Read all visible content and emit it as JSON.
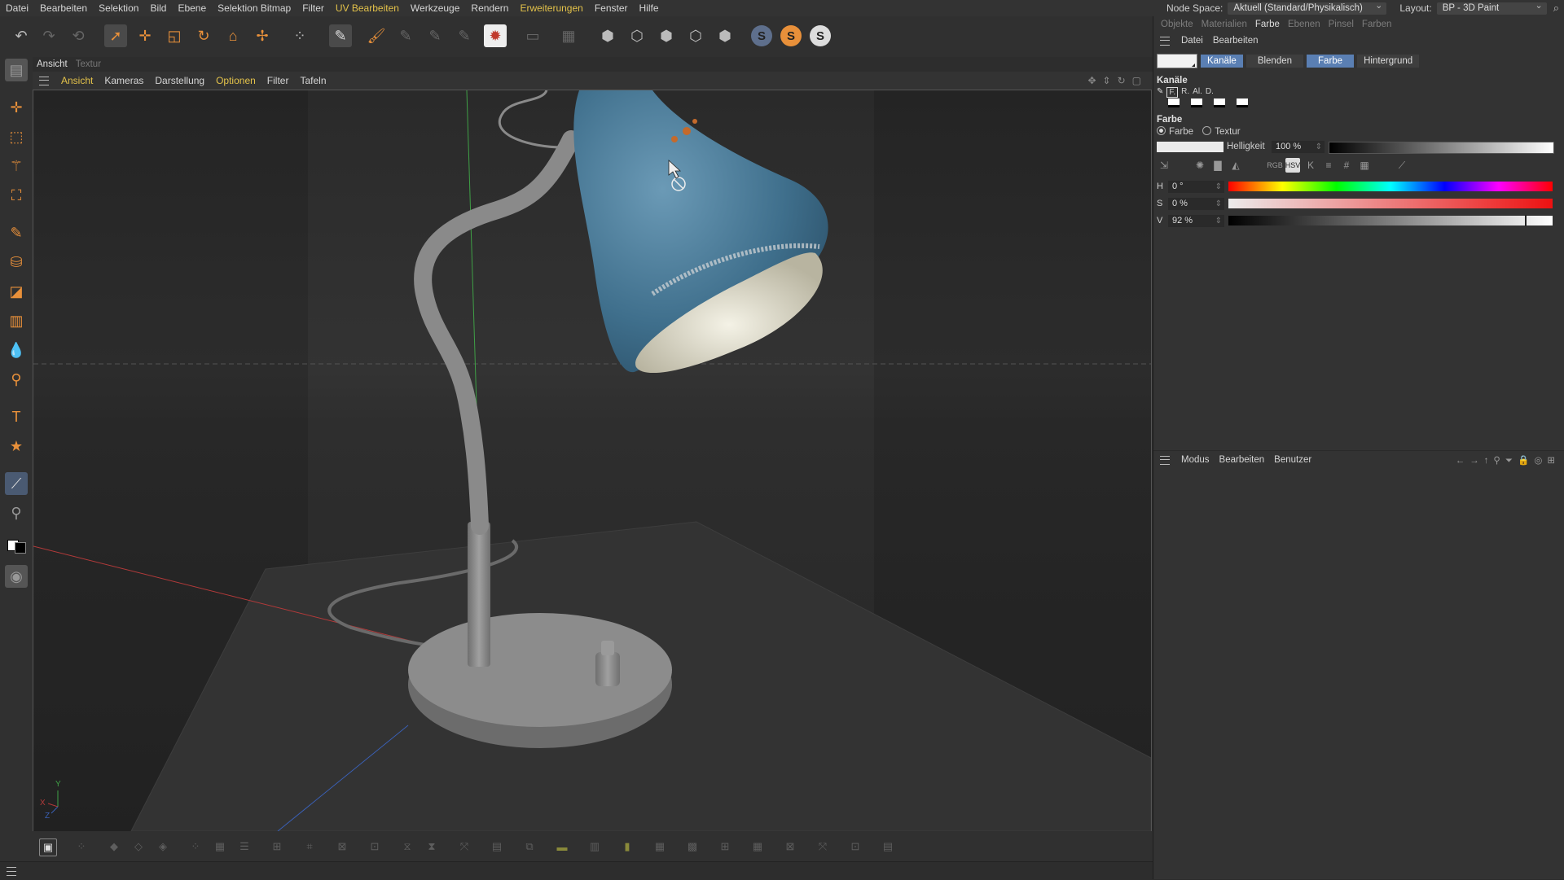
{
  "menubar": {
    "items": [
      {
        "label": "Datei",
        "hl": false
      },
      {
        "label": "Bearbeiten",
        "hl": false
      },
      {
        "label": "Selektion",
        "hl": false
      },
      {
        "label": "Bild",
        "hl": false
      },
      {
        "label": "Ebene",
        "hl": false
      },
      {
        "label": "Selektion Bitmap",
        "hl": false
      },
      {
        "label": "Filter",
        "hl": false
      },
      {
        "label": "UV Bearbeiten",
        "hl": true
      },
      {
        "label": "Werkzeuge",
        "hl": false
      },
      {
        "label": "Rendern",
        "hl": false
      },
      {
        "label": "Erweiterungen",
        "hl": true
      },
      {
        "label": "Fenster",
        "hl": false
      },
      {
        "label": "Hilfe",
        "hl": false
      }
    ],
    "node_space_label": "Node Space:",
    "node_space_value": "Aktuell (Standard/Physikalisch)",
    "layout_label": "Layout:",
    "layout_value": "BP - 3D Paint",
    "search_icon": "search-icon"
  },
  "view_tabs": {
    "ansicht": "Ansicht",
    "textur": "Textur"
  },
  "view_menu": {
    "items": [
      {
        "label": "Ansicht",
        "hl": true
      },
      {
        "label": "Kameras",
        "hl": false
      },
      {
        "label": "Darstellung",
        "hl": false
      },
      {
        "label": "Optionen",
        "hl": true
      },
      {
        "label": "Filter",
        "hl": false
      },
      {
        "label": "Tafeln",
        "hl": false
      }
    ]
  },
  "viewport": {
    "axis_y": "Y",
    "axis_x": "X",
    "axis_z": "Z",
    "colors": {
      "shade_blue": "#4a7c9a",
      "lamp_gray": "#8a8a8a",
      "floor": "#3a3a3a",
      "y_axis": "#4caf50",
      "x_axis": "#c0392b"
    }
  },
  "right_panel": {
    "tabs": [
      {
        "label": "Objekte",
        "active": false
      },
      {
        "label": "Materialien",
        "active": false
      },
      {
        "label": "Farbe",
        "active": true
      },
      {
        "label": "Ebenen",
        "active": false
      },
      {
        "label": "Pinsel",
        "active": false
      },
      {
        "label": "Farben",
        "active": false
      }
    ],
    "menu": {
      "datei": "Datei",
      "bearbeiten": "Bearbeiten"
    },
    "buttons": [
      {
        "label": "Kanäle",
        "on": true
      },
      {
        "label": "Blenden",
        "on": false
      },
      {
        "label": "Farbe",
        "on": true
      },
      {
        "label": "Hintergrund",
        "on": false
      }
    ],
    "channels_title": "Kanäle",
    "channels": [
      "F.",
      "R.",
      "Al.",
      "D."
    ],
    "farbe_title": "Farbe",
    "radio_farbe": "Farbe",
    "radio_textur": "Textur",
    "helligkeit_label": "Helligkeit",
    "helligkeit_value": "100 %",
    "mode_buttons": [
      "RGB",
      "HSV",
      "K",
      "≡",
      "#",
      "▦"
    ],
    "hsv": {
      "h_label": "H",
      "h_value": "0 °",
      "s_label": "S",
      "s_value": "0 %",
      "v_label": "V",
      "v_value": "92 %",
      "v_fraction": 0.92
    },
    "lower_menu": {
      "modus": "Modus",
      "bearbeiten": "Bearbeiten",
      "benutzer": "Benutzer"
    },
    "current_color": "#ebebeb"
  }
}
